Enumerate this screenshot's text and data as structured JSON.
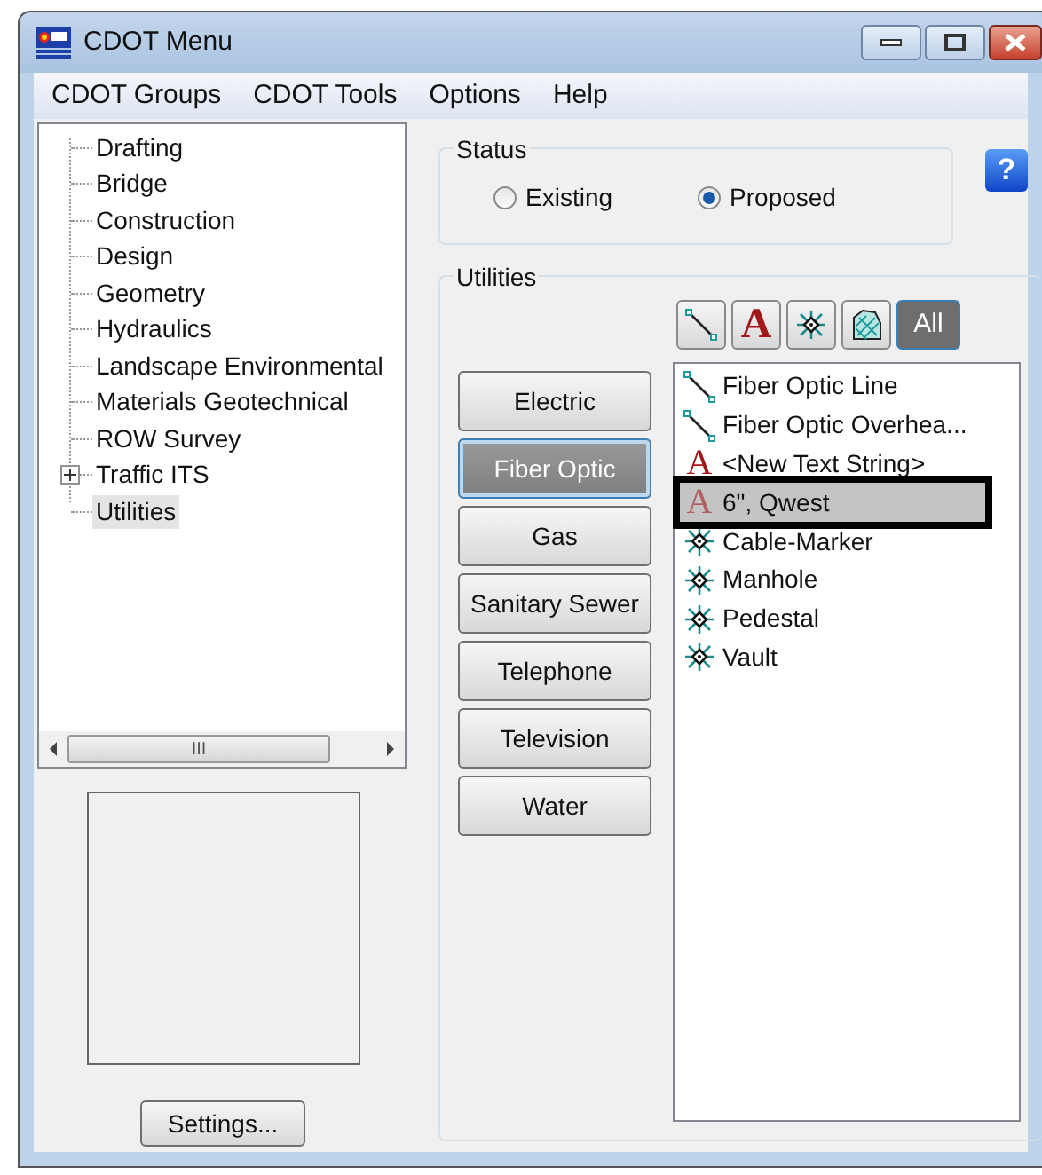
{
  "window": {
    "title": "CDOT Menu"
  },
  "menu": [
    "CDOT Groups",
    "CDOT Tools",
    "Options",
    "Help"
  ],
  "tree": [
    {
      "label": "Drafting",
      "expandable": false,
      "selected": false
    },
    {
      "label": "Bridge",
      "expandable": false,
      "selected": false
    },
    {
      "label": "Construction",
      "expandable": false,
      "selected": false
    },
    {
      "label": "Design",
      "expandable": false,
      "selected": false
    },
    {
      "label": "Geometry",
      "expandable": false,
      "selected": false
    },
    {
      "label": "Hydraulics",
      "expandable": false,
      "selected": false
    },
    {
      "label": "Landscape Environmental",
      "expandable": false,
      "selected": false
    },
    {
      "label": "Materials Geotechnical",
      "expandable": false,
      "selected": false
    },
    {
      "label": "ROW Survey",
      "expandable": false,
      "selected": false
    },
    {
      "label": "Traffic ITS",
      "expandable": true,
      "selected": false
    },
    {
      "label": "Utilities",
      "expandable": false,
      "selected": true
    }
  ],
  "tree_scrollbar": {
    "grip": "III"
  },
  "settings_button": "Settings...",
  "status": {
    "title": "Status",
    "options": [
      {
        "label": "Existing",
        "selected": false
      },
      {
        "label": "Proposed",
        "selected": true
      }
    ]
  },
  "help_button": "?",
  "utilities": {
    "title": "Utilities",
    "filters": [
      {
        "kind": "line",
        "selected": false
      },
      {
        "kind": "text",
        "label": "A",
        "selected": false
      },
      {
        "kind": "cell",
        "selected": false
      },
      {
        "kind": "pattern",
        "selected": false
      },
      {
        "kind": "all",
        "label": "All",
        "selected": true
      }
    ],
    "categories": [
      {
        "label": "Electric",
        "selected": false
      },
      {
        "label": "Fiber Optic",
        "selected": true
      },
      {
        "label": "Gas",
        "selected": false
      },
      {
        "label": "Sanitary Sewer",
        "selected": false
      },
      {
        "label": "Telephone",
        "selected": false
      },
      {
        "label": "Television",
        "selected": false
      },
      {
        "label": "Water",
        "selected": false
      }
    ],
    "items": [
      {
        "kind": "line",
        "label": "Fiber Optic Line",
        "selected": false
      },
      {
        "kind": "line",
        "label": "Fiber Optic Overhea...",
        "selected": false
      },
      {
        "kind": "text",
        "icon": "A",
        "label": "<New Text String>",
        "selected": false
      },
      {
        "kind": "text",
        "icon": "A",
        "label": "6\", Qwest",
        "selected": true
      },
      {
        "kind": "cell",
        "label": "Cable-Marker",
        "selected": false
      },
      {
        "kind": "cell",
        "label": "Manhole",
        "selected": false
      },
      {
        "kind": "cell",
        "label": "Pedestal",
        "selected": false
      },
      {
        "kind": "cell",
        "label": "Vault",
        "selected": false
      }
    ]
  }
}
